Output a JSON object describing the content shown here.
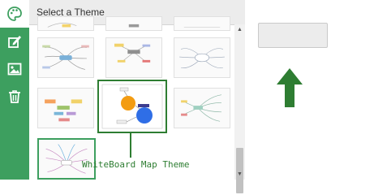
{
  "panel": {
    "title": "Select a Theme"
  },
  "sidebar": {
    "items": [
      {
        "name": "palette-icon",
        "active": true
      },
      {
        "name": "edit-style-icon",
        "active": false
      },
      {
        "name": "image-icon",
        "active": false
      },
      {
        "name": "trash-icon",
        "active": false
      }
    ]
  },
  "annotation": {
    "label": "WhiteBoard Map Theme"
  },
  "colors": {
    "sidebar": "#3d9f5f",
    "accent": "#2e7d32",
    "orange": "#f39c12",
    "blue": "#2f6ee6"
  }
}
